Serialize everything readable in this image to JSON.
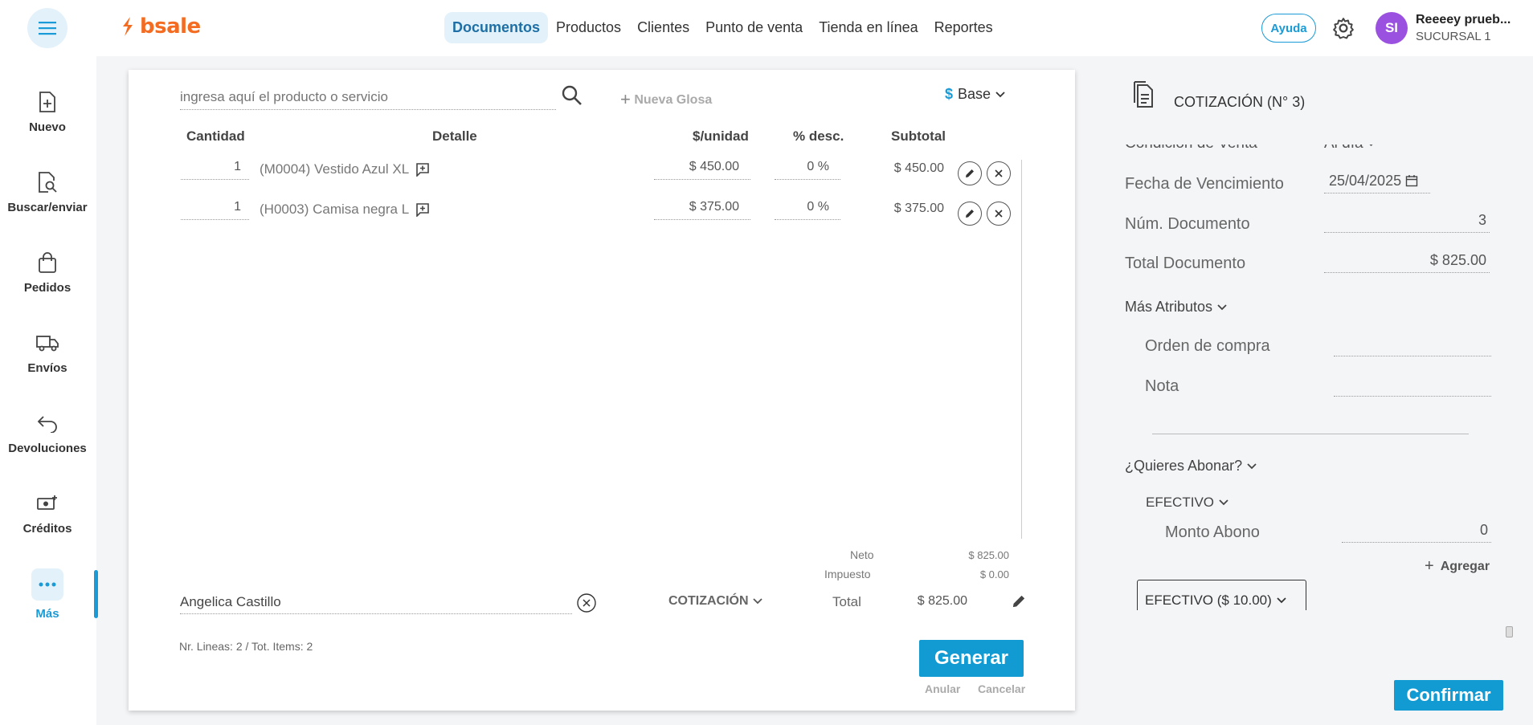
{
  "header": {
    "nav": [
      "Documentos",
      "Productos",
      "Clientes",
      "Punto de venta",
      "Tienda en línea",
      "Reportes"
    ],
    "ayuda": "Ayuda",
    "avatar_initials": "SI",
    "user_name": "Reeeey prueb...",
    "user_branch": "SUCURSAL 1"
  },
  "sidebar": {
    "items": [
      {
        "label": "Nuevo",
        "icon": "file-plus-icon"
      },
      {
        "label": "Buscar/enviar",
        "icon": "file-search-icon"
      },
      {
        "label": "Pedidos",
        "icon": "bag-icon"
      },
      {
        "label": "Envíos",
        "icon": "truck-icon"
      },
      {
        "label": "Devoluciones",
        "icon": "return-icon"
      },
      {
        "label": "Créditos",
        "icon": "money-plus-icon"
      },
      {
        "label": "Más",
        "icon": "more-dots-icon"
      }
    ]
  },
  "editor": {
    "search_placeholder": "ingresa aquí el producto o servicio",
    "nueva_glosa": "Nueva Glosa",
    "currency_symbol": "$",
    "price_list": "Base",
    "columns": {
      "cantidad": "Cantidad",
      "detalle": "Detalle",
      "unidad": "$/unidad",
      "desc": "% desc.",
      "subtotal": "Subtotal"
    },
    "lines": [
      {
        "qty": "1",
        "detail": "(M0004) Vestido Azul XL",
        "price": "$ 450.00",
        "discount": "0 %",
        "subtotal": "$ 450.00"
      },
      {
        "qty": "1",
        "detail": "(H0003) Camisa negra L",
        "price": "$ 375.00",
        "discount": "0 %",
        "subtotal": "$ 375.00"
      }
    ],
    "neto_label": "Neto",
    "neto_value": "$ 825.00",
    "impuesto_label": "Impuesto",
    "impuesto_value": "$ 0.00",
    "client": "Angelica Castillo",
    "doc_type": "COTIZACIÓN",
    "total_label": "Total",
    "total_value": "$ 825.00",
    "summary": "Nr. Lineas: 2 / Tot. Items: 2",
    "generar": "Generar",
    "anular": "Anular",
    "cancelar": "Cancelar"
  },
  "panel": {
    "title": "COTIZACIÓN (N° 3)",
    "condicion_label": "Condición de Venta",
    "condicion_value": "Al día",
    "vencimiento_label": "Fecha de Vencimiento",
    "vencimiento_value": "25/04/2025",
    "num_label": "Núm. Documento",
    "num_value": "3",
    "total_label": "Total Documento",
    "total_value": "$ 825.00",
    "mas_atributos": "Más Atributos",
    "orden_label": "Orden de compra",
    "nota_label": "Nota",
    "quieres_abonar": "¿Quieres Abonar?",
    "efectivo": "EFECTIVO",
    "monto_label": "Monto Abono",
    "monto_value": "0",
    "agregar": "Agregar",
    "payment_box": "EFECTIVO ($ 10.00)",
    "confirmar": "Confirmar"
  },
  "colors": {
    "accent": "#129ad2",
    "brand": "#f36c21",
    "avatar": "#9b51e0"
  }
}
